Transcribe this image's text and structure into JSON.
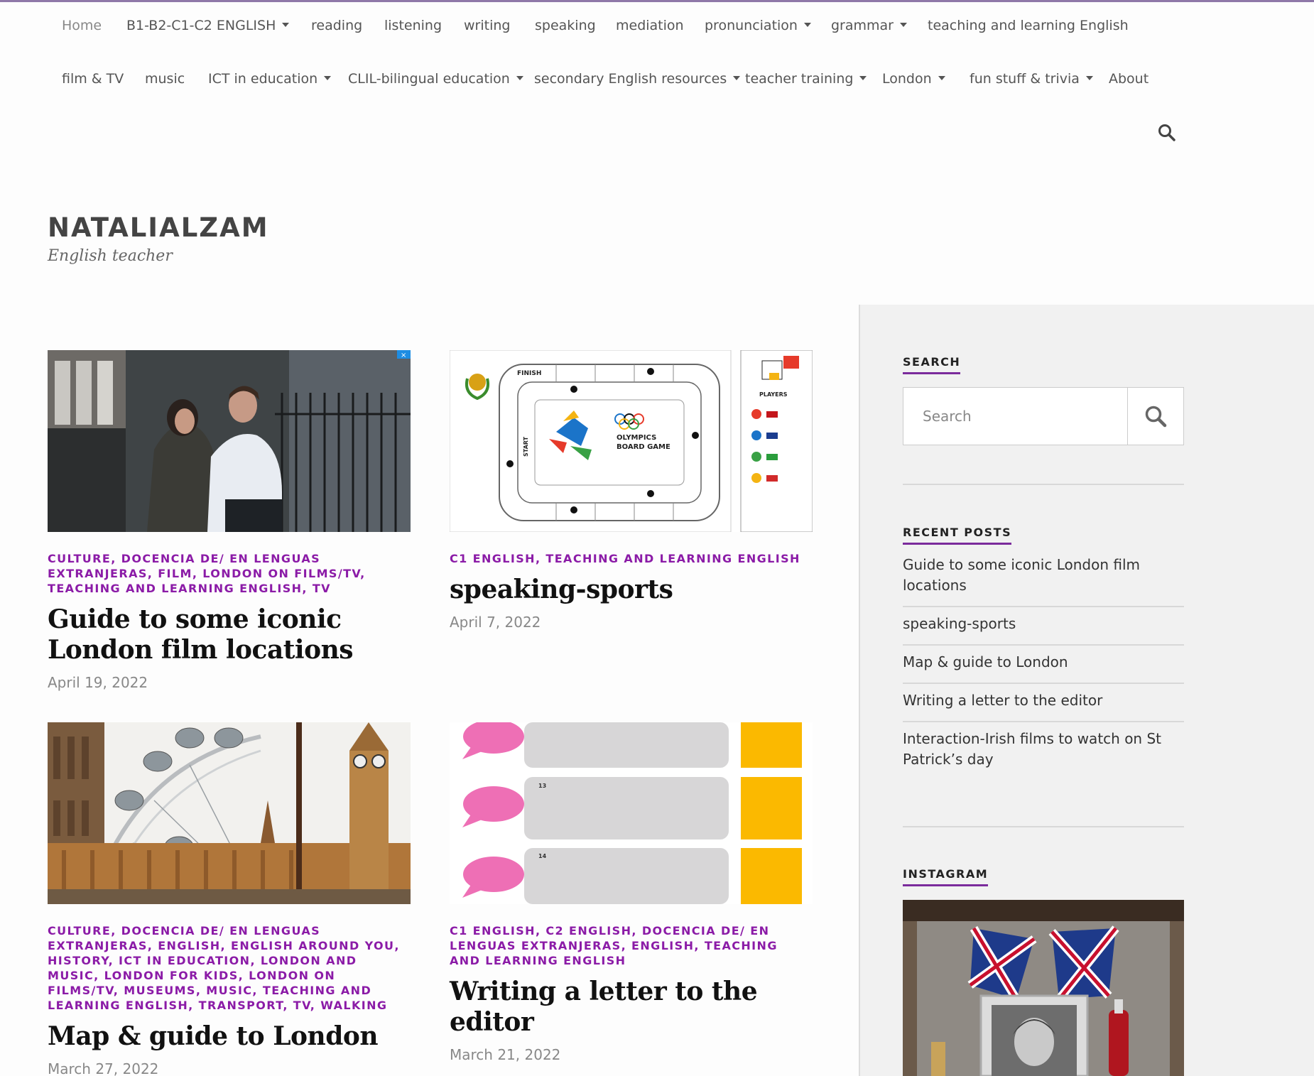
{
  "nav": {
    "row1": [
      {
        "label": "Home",
        "active": true
      },
      {
        "label": "B1-B2-C1-C2 ENGLISH",
        "dropdown": true
      },
      {
        "label": "reading"
      },
      {
        "label": "listening"
      },
      {
        "label": "writing"
      },
      {
        "label": "speaking"
      },
      {
        "label": "mediation"
      },
      {
        "label": "pronunciation",
        "dropdown": true
      },
      {
        "label": "grammar",
        "dropdown": true
      },
      {
        "label": "teaching and learning English"
      }
    ],
    "row2": [
      {
        "label": "film & TV"
      },
      {
        "label": "music"
      },
      {
        "label": "ICT in education",
        "dropdown": true
      },
      {
        "label": "CLIL-bilingual education",
        "dropdown": true
      },
      {
        "label": "secondary English resources",
        "dropdown": true
      },
      {
        "label": "teacher training",
        "dropdown": true
      },
      {
        "label": "London",
        "dropdown": true
      },
      {
        "label": "fun stuff & trivia",
        "dropdown": true
      },
      {
        "label": "About"
      }
    ],
    "search_icon": "search-icon"
  },
  "site": {
    "title": "NATALIALZAM",
    "description": "English teacher"
  },
  "posts": [
    {
      "categories": "CULTURE, DOCENCIA DE/ EN LENGUAS EXTRANJERAS, FILM, LONDON ON FILMS/TV, TEACHING AND LEARNING ENGLISH, TV",
      "title": "Guide to some iconic London film locations",
      "date": "April 19, 2022",
      "thumb": "film-still-street"
    },
    {
      "categories": "C1 ENGLISH, TEACHING AND LEARNING ENGLISH",
      "title": "speaking-sports",
      "date": "April 7, 2022",
      "thumb": "olympics-board-game",
      "thumb_text": {
        "finish": "FINISH",
        "start": "START",
        "game_title": "OLYMPICS",
        "game_subtitle": "BOARD GAME",
        "players": "PLAYERS"
      }
    },
    {
      "categories": "CULTURE, DOCENCIA DE/ EN LENGUAS EXTRANJERAS, ENGLISH, ENGLISH AROUND YOU, HISTORY, ICT IN EDUCATION, LONDON AND MUSIC, LONDON FOR KIDS, LONDON ON FILMS/TV, MUSEUMS, MUSIC, TEACHING AND LEARNING ENGLISH, TRANSPORT, TV, WALKING",
      "title": "Map & guide to London",
      "date": "March 27, 2022",
      "thumb": "london-eye-big-ben"
    },
    {
      "categories": "C1 ENGLISH, C2 ENGLISH, DOCENCIA DE/ EN LENGUAS EXTRANJERAS, ENGLISH, TEACHING AND LEARNING ENGLISH",
      "title": "Writing a letter to the editor",
      "date": "March 21, 2022",
      "thumb": "speech-bubbles-worksheet",
      "thumb_text": {
        "num1": "13",
        "num2": "14"
      }
    }
  ],
  "sidebar": {
    "search": {
      "title": "SEARCH",
      "placeholder": "Search"
    },
    "recent": {
      "title": "RECENT POSTS",
      "items": [
        "Guide to some iconic London film locations",
        "speaking-sports",
        "Map & guide to London",
        "Writing a letter to the editor",
        "Interaction-Irish films to watch on St Patrick’s day"
      ]
    },
    "instagram": {
      "title": "INSTAGRAM",
      "image": "union-jack-queen-photo"
    }
  },
  "colors": {
    "accent": "#8b1ba7",
    "underline": "#7b2b9c",
    "topbar": "#8f78a8",
    "sidebar_bg": "#f1f1f1"
  }
}
